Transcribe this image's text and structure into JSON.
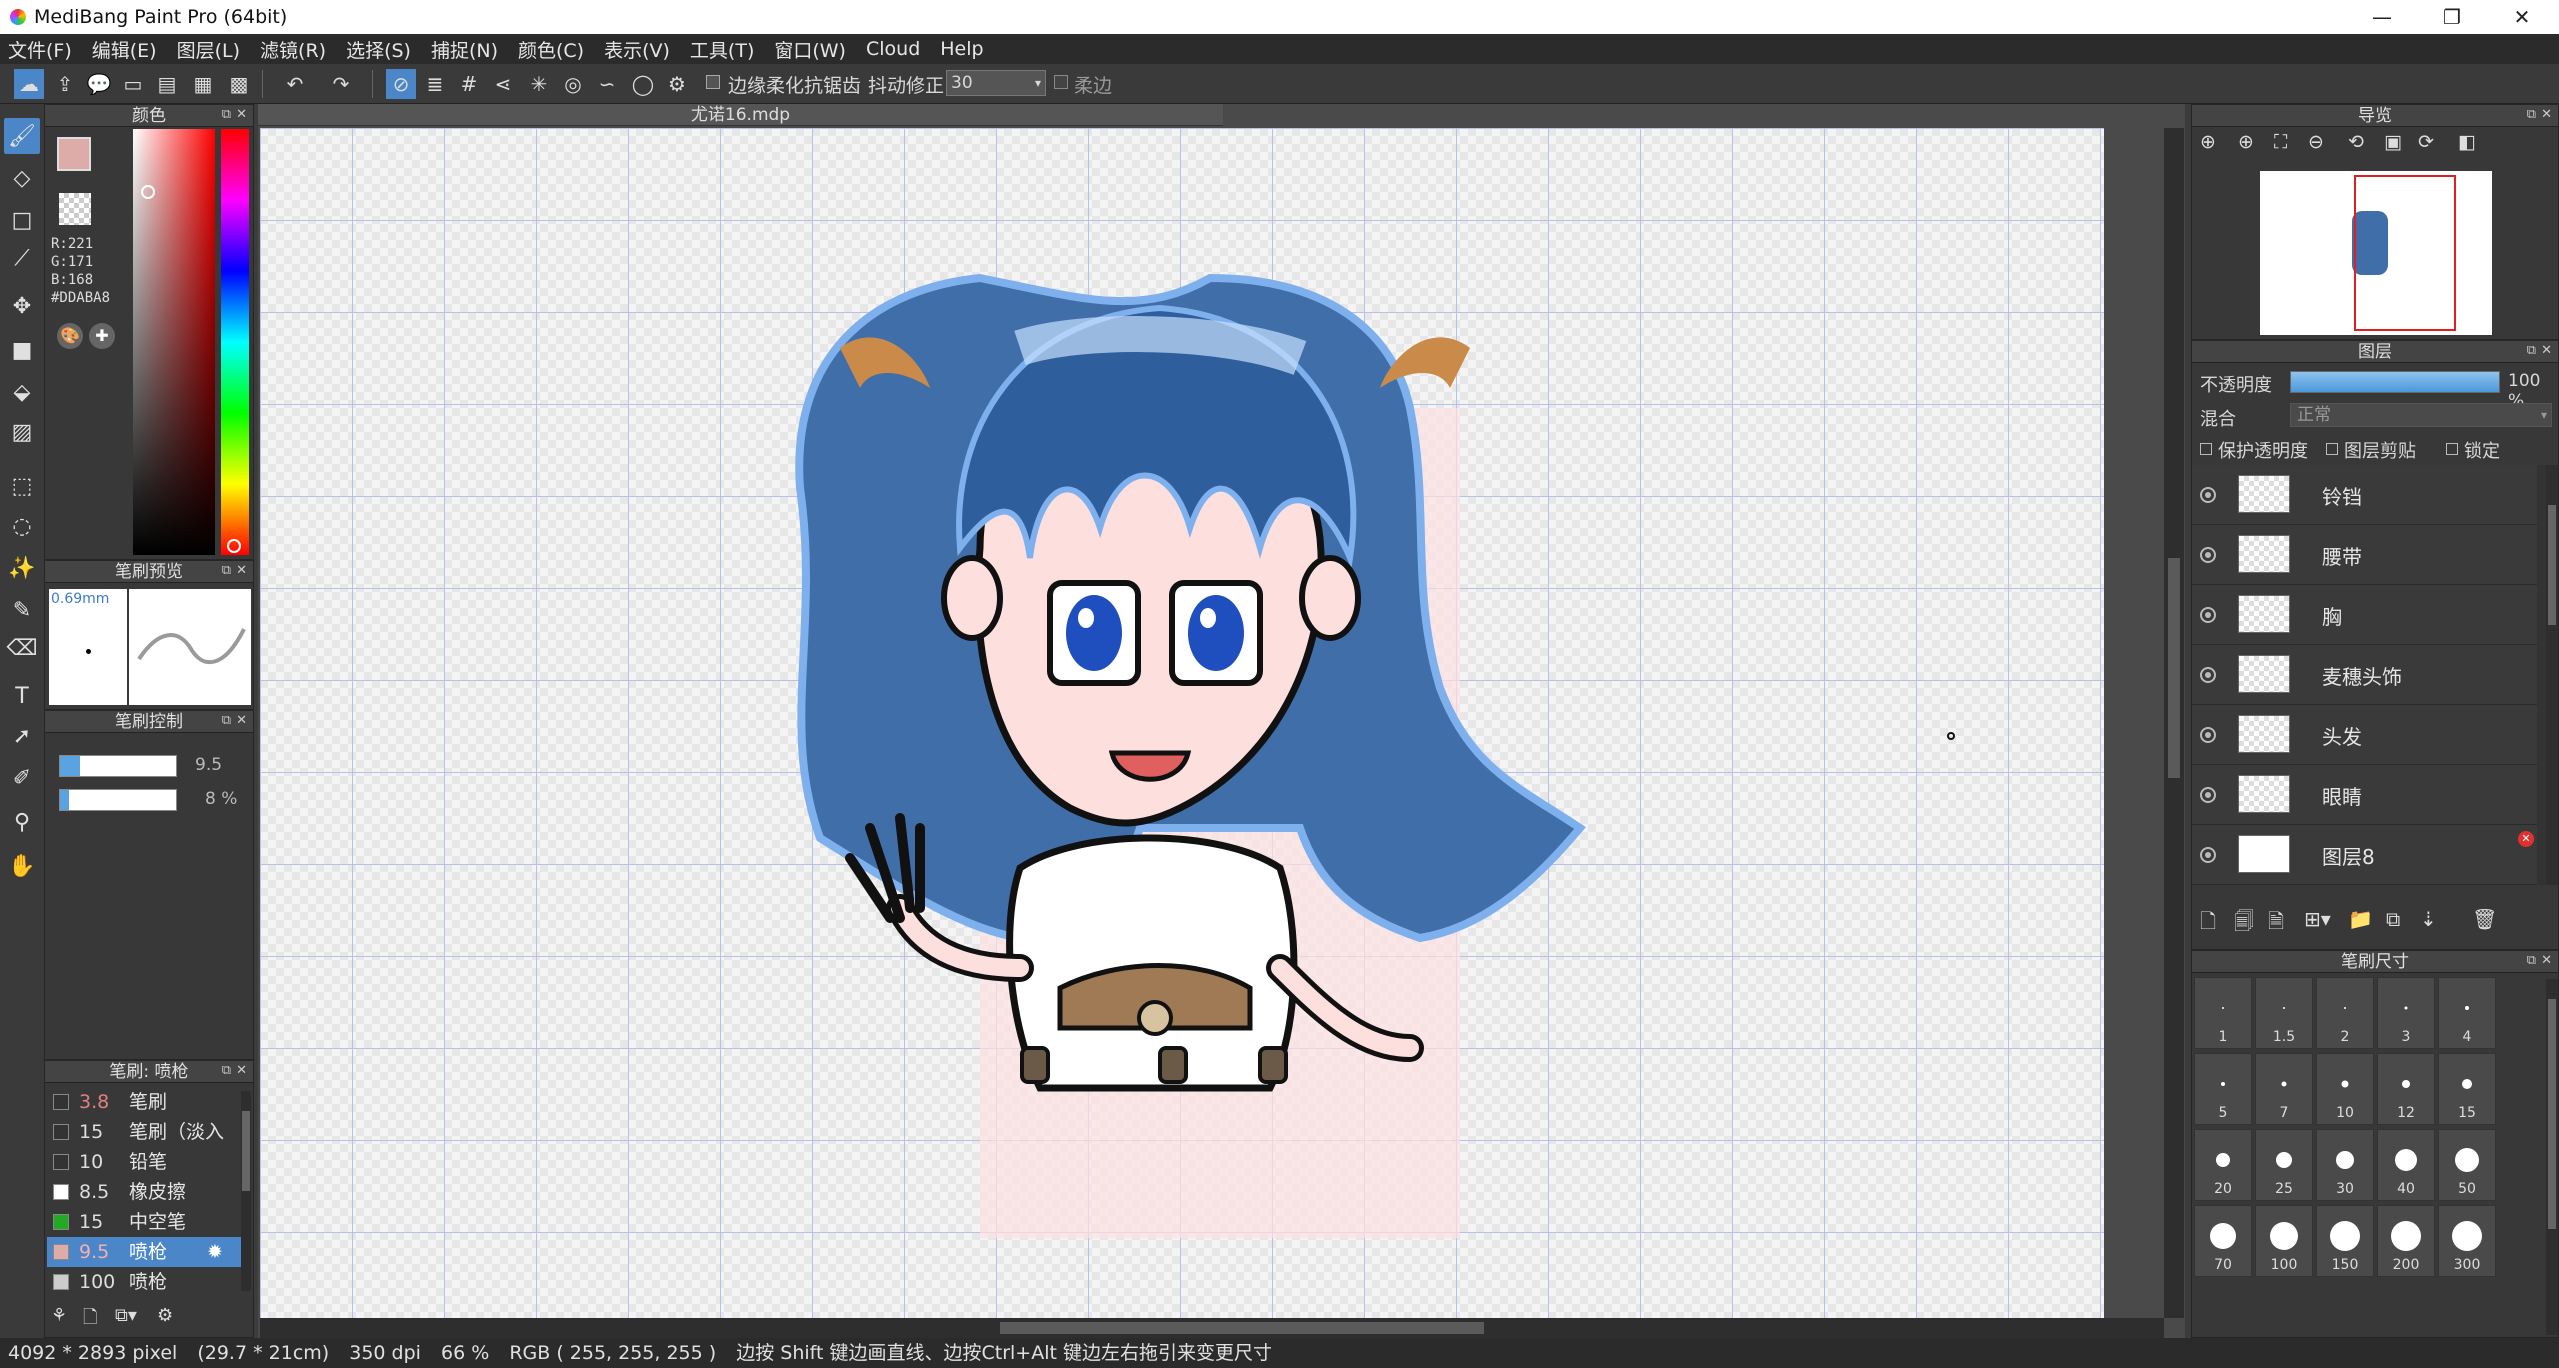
{
  "window": {
    "title": "MediBang Paint Pro (64bit)",
    "minimize": "—",
    "maximize": "❐",
    "close": "✕"
  },
  "menu": [
    "文件(F)",
    "编辑(E)",
    "图层(L)",
    "滤镜(R)",
    "选择(S)",
    "捕捉(N)",
    "颜色(C)",
    "表示(V)",
    "工具(T)",
    "窗口(W)",
    "Cloud",
    "Help"
  ],
  "toolbar": {
    "antialias_label": "边缘柔化抗锯齿",
    "stabilizer_label": "抖动修正",
    "stabilizer_value": "30",
    "soft_edge_label": "柔边"
  },
  "color_panel": {
    "title": "颜色",
    "r": "R:221",
    "g": "G:171",
    "b": "B:168",
    "hex": "#DDABA8",
    "fg_color": "#DDABA8",
    "bg_color": "#1f3f78"
  },
  "brush_preview": {
    "title": "笔刷预览",
    "size": "0.69mm"
  },
  "brush_control": {
    "title": "笔刷控制",
    "size_value": "9.5",
    "opacity_value": "8 %"
  },
  "brush_list": {
    "title": "笔刷: 喷枪",
    "items": [
      {
        "size": "3.8",
        "name": "笔刷",
        "color": "#333333",
        "selected": false
      },
      {
        "size": "15",
        "name": "笔刷（淡入",
        "color": "#333333",
        "selected": false
      },
      {
        "size": "10",
        "name": "铅笔",
        "color": "#333333",
        "selected": false
      },
      {
        "size": "8.5",
        "name": "橡皮擦",
        "color": "#ffffff",
        "selected": false
      },
      {
        "size": "15",
        "name": "中空笔",
        "color": "#22aa22",
        "selected": false
      },
      {
        "size": "9.5",
        "name": "喷枪",
        "color": "#DDABA8",
        "selected": true
      },
      {
        "size": "100",
        "name": "喷枪",
        "color": "#cccccc",
        "selected": false
      }
    ]
  },
  "document": {
    "tab": "尤诺16.mdp"
  },
  "navigator": {
    "title": "导览"
  },
  "layers": {
    "title": "图层",
    "opacity_label": "不透明度",
    "opacity_value": "100 %",
    "opacity": 1.0,
    "blend_label": "混合",
    "blend_value": "正常",
    "protect_alpha": "保护透明度",
    "clipping": "图层剪贴",
    "lock": "锁定",
    "items": [
      "铃铛",
      "腰带",
      "胸",
      "麦穗头饰",
      "头发",
      "眼睛",
      "图层8"
    ]
  },
  "brush_size": {
    "title": "笔刷尺寸",
    "sizes": [
      "1",
      "1.5",
      "2",
      "3",
      "4",
      "5",
      "7",
      "10",
      "12",
      "15",
      "20",
      "25",
      "30",
      "40",
      "50",
      "70",
      "100",
      "150",
      "200",
      "300"
    ]
  },
  "status": {
    "dimensions": "4092 * 2893 pixel",
    "physical": "(29.7 * 21cm)",
    "dpi": "350 dpi",
    "zoom": "66 %",
    "rgb": "RGB ( 255, 255, 255 )",
    "hint": "边按 Shift 键边画直线、边按Ctrl+Alt 键边左右拖引来变更尺寸"
  }
}
